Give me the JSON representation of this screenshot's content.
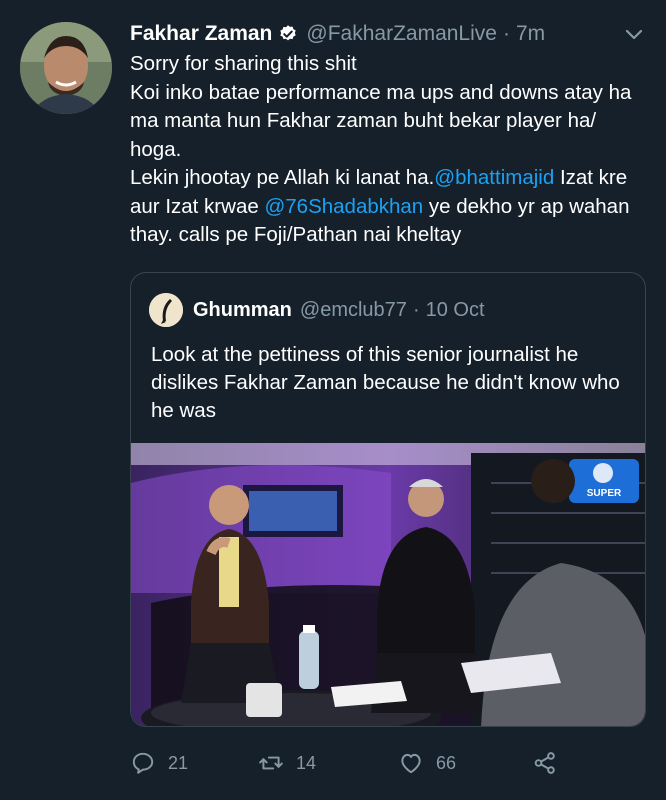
{
  "tweet": {
    "author_name": "Fakhar Zaman",
    "handle": "@FakharZamanLive",
    "separator": "·",
    "time": "7m",
    "lines": [
      "Sorry for sharing this shit",
      "Koi inko batae performance ma ups and downs atay ha ma manta hun Fakhar zaman buht bekar player ha/ hoga."
    ],
    "para3_before": "Lekin jhootay pe Allah ki lanat ha.",
    "mention_1": "@bhattimajid",
    "para3_mid": " Izat kre aur Izat krwae ",
    "mention_2": "@76Shadabkhan",
    "para3_after": " ye dekho yr ap wahan thay. calls pe Foji/Pathan nai kheltay"
  },
  "quoted": {
    "author_name": "Ghumman",
    "handle": "@emclub77",
    "separator": "·",
    "time": "10 Oct",
    "text": "Look at the pettiness of this senior journalist he dislikes Fakhar Zaman because he didn't know who he was",
    "media_logo": "SUPER"
  },
  "actions": {
    "replies": "21",
    "retweets": "14",
    "likes": "66"
  },
  "colors": {
    "background": "#15202b",
    "accent": "#1da1f2",
    "muted": "#8899a6",
    "border": "#38444d"
  },
  "icons": [
    "verified-badge-icon",
    "chevron-down-icon",
    "reply-icon",
    "retweet-icon",
    "like-icon",
    "share-icon"
  ]
}
